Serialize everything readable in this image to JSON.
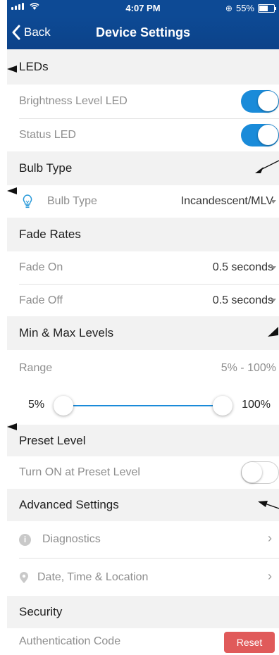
{
  "status_bar": {
    "time": "4:07 PM",
    "battery": "55%",
    "battery_level": 0.55
  },
  "nav": {
    "back_label": "Back",
    "title": "Device Settings"
  },
  "sections": {
    "leds": {
      "title": "LEDs",
      "brightness_label": "Brightness Level LED",
      "brightness_on": true,
      "status_label": "Status LED",
      "status_on": true
    },
    "bulb": {
      "title": "Bulb Type",
      "label": "Bulb Type",
      "value": "Incandescent/MLV",
      "icon": "lightbulb-icon"
    },
    "fade": {
      "title": "Fade Rates",
      "on_label": "Fade On",
      "on_value": "0.5 seconds",
      "off_label": "Fade Off",
      "off_value": "0.5 seconds"
    },
    "levels": {
      "title": "Min & Max Levels",
      "range_label": "Range",
      "range_value": "5% - 100%",
      "min": "5%",
      "max": "100%"
    },
    "preset": {
      "title": "Preset Level",
      "label": "Turn ON at Preset Level",
      "on": false
    },
    "advanced": {
      "title": "Advanced Settings",
      "diagnostics": "Diagnostics",
      "datetime": "Date, Time & Location"
    },
    "security": {
      "title": "Security",
      "auth_label": "Authentication Code",
      "reset_label": "Reset"
    }
  },
  "colors": {
    "nav": "#0d4a95",
    "accent": "#1a8bd9",
    "header_bg": "#f2f2f2",
    "reset": "#e05a5a"
  }
}
